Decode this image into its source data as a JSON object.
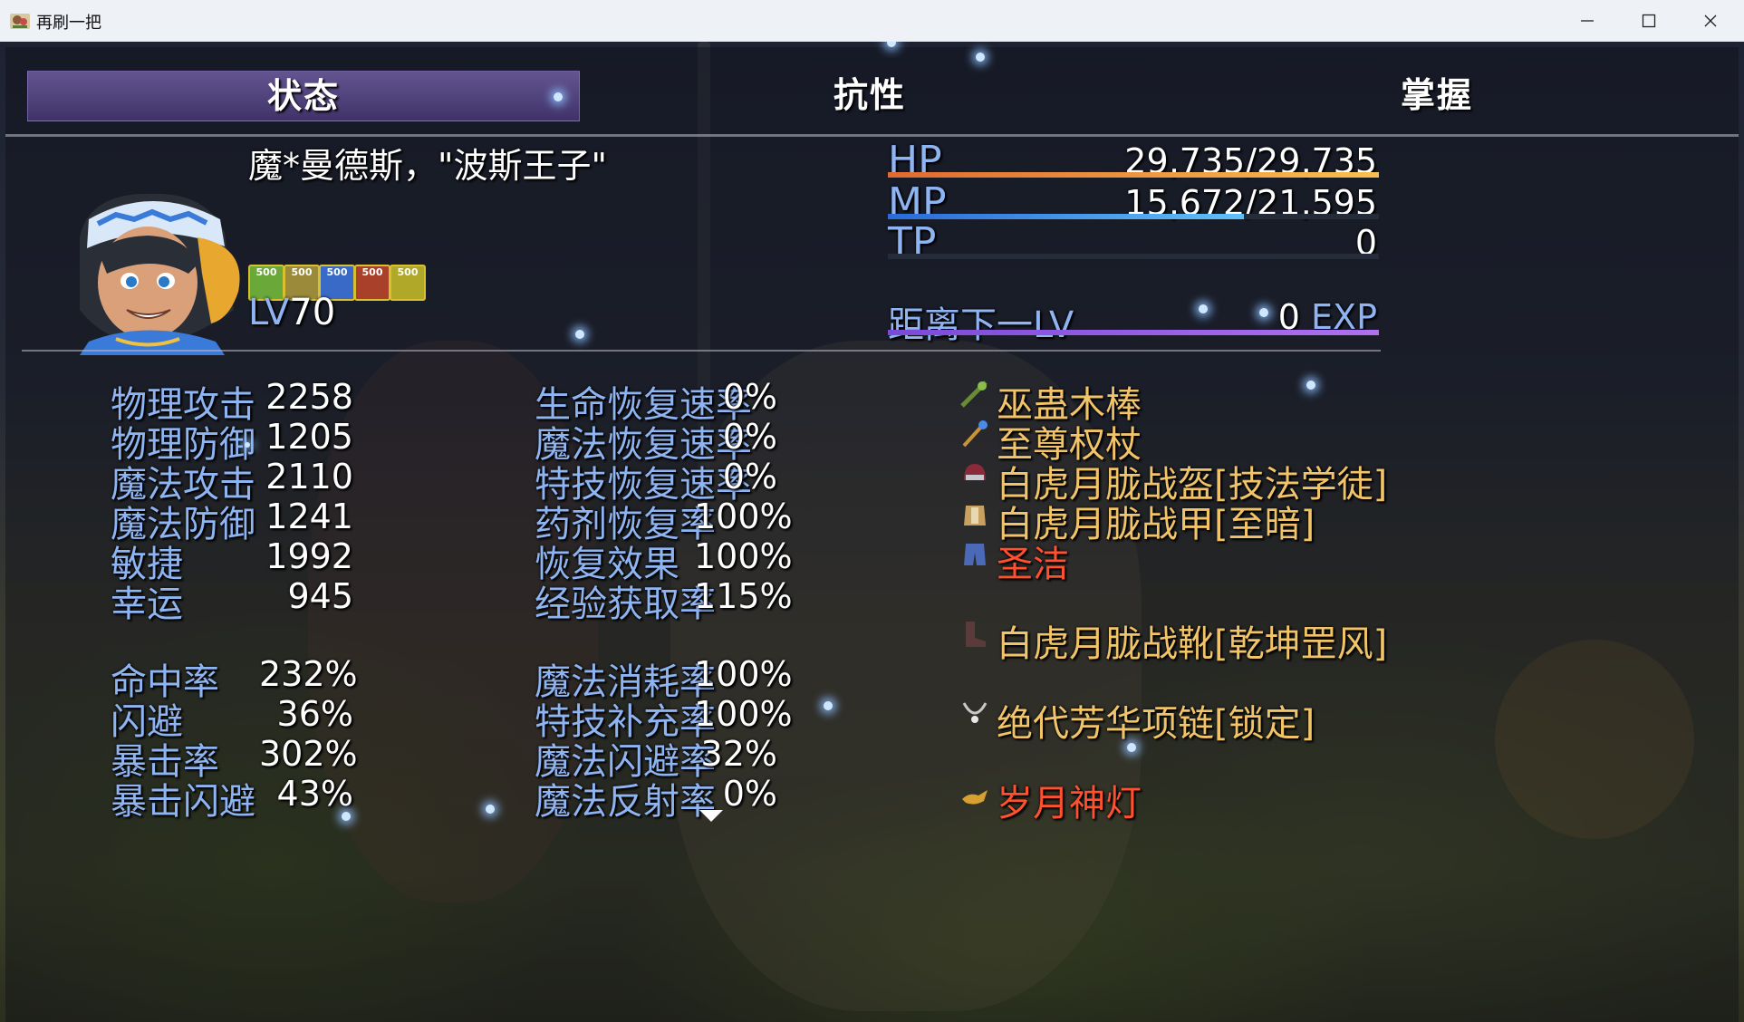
{
  "window": {
    "title": "再刷一把",
    "minimize": "—",
    "maximize": "☐",
    "close": "✕"
  },
  "tabs": [
    {
      "label": "状态",
      "selected": true
    },
    {
      "label": "抗性",
      "selected": false
    },
    {
      "label": "掌握",
      "selected": false
    }
  ],
  "character": {
    "name": "魔*曼德斯，\"波斯王子\"",
    "level_label": "LV",
    "level": "70",
    "buffs": [
      {
        "value": "500",
        "icon": "green-buff-icon",
        "color": "#6aa83a"
      },
      {
        "value": "500",
        "icon": "gold-buff-icon",
        "color": "#9a8a3a"
      },
      {
        "value": "500",
        "icon": "blue-buff-icon",
        "color": "#3a6ac8"
      },
      {
        "value": "500",
        "icon": "red-buff-icon",
        "color": "#a8402a"
      },
      {
        "value": "500",
        "icon": "yellow-buff-icon",
        "color": "#b0a828"
      }
    ]
  },
  "gauges": {
    "hp": {
      "label": "HP",
      "value": "29,735/29,735",
      "fraction": 1.0,
      "color": "#f0a050"
    },
    "mp": {
      "label": "MP",
      "value": "15,672/21,595",
      "fraction": 0.726,
      "color": "#3a9ae8"
    },
    "tp": {
      "label": "TP",
      "value": "0",
      "fraction": 0.0,
      "color": "#3a8a3a"
    },
    "exp": {
      "label": "距离下一LV",
      "value": "0",
      "unit": "EXP",
      "fraction": 1.0,
      "color": "#9a5ae8"
    }
  },
  "stats_left": [
    {
      "label": "物理攻击",
      "value": "2258"
    },
    {
      "label": "物理防御",
      "value": "1205"
    },
    {
      "label": "魔法攻击",
      "value": "2110"
    },
    {
      "label": "魔法防御",
      "value": "1241"
    },
    {
      "label": "敏捷",
      "value": "1992"
    },
    {
      "label": "幸运",
      "value": "945"
    }
  ],
  "stats_left2": [
    {
      "label": "命中率",
      "value": "232%"
    },
    {
      "label": "闪避",
      "value": "36%"
    },
    {
      "label": "暴击率",
      "value": "302%"
    },
    {
      "label": "暴击闪避",
      "value": "43%"
    }
  ],
  "stats_mid": [
    {
      "label": "生命恢复速率",
      "value": "0%"
    },
    {
      "label": "魔法恢复速率",
      "value": "0%"
    },
    {
      "label": "特技恢复速率",
      "value": "0%"
    },
    {
      "label": "药剂恢复率",
      "value": "100%"
    },
    {
      "label": "恢复效果",
      "value": "100%"
    },
    {
      "label": "经验获取率",
      "value": "115%"
    }
  ],
  "stats_mid2": [
    {
      "label": "魔法消耗率",
      "value": "100%"
    },
    {
      "label": "特技补充率",
      "value": "100%"
    },
    {
      "label": "魔法闪避率",
      "value": "32%"
    },
    {
      "label": "魔法反射率",
      "value": "0%"
    }
  ],
  "equipment": [
    {
      "name": "巫蛊木棒",
      "icon": "wooden-staff-icon",
      "color": "#f2c46a"
    },
    {
      "name": "至尊权杖",
      "icon": "scepter-icon",
      "color": "#f2c46a"
    },
    {
      "name": "白虎月胧战盔[技法学徒]",
      "icon": "helmet-icon",
      "color": "#f2c46a"
    },
    {
      "name": "白虎月胧战甲[至暗]",
      "icon": "armor-icon",
      "color": "#f2c46a"
    },
    {
      "name": "圣洁",
      "icon": "pants-icon",
      "color": "#ff5030"
    },
    {
      "name": "白虎月胧战靴[乾坤罡风]",
      "icon": "boots-icon",
      "color": "#f2c46a"
    },
    {
      "name": "绝代芳华项链[锁定]",
      "icon": "necklace-icon",
      "color": "#f2c46a"
    },
    {
      "name": "岁月神灯",
      "icon": "magic-lamp-icon",
      "color": "#ff5030"
    }
  ],
  "scroll_indicator": "more-down-arrow-icon"
}
